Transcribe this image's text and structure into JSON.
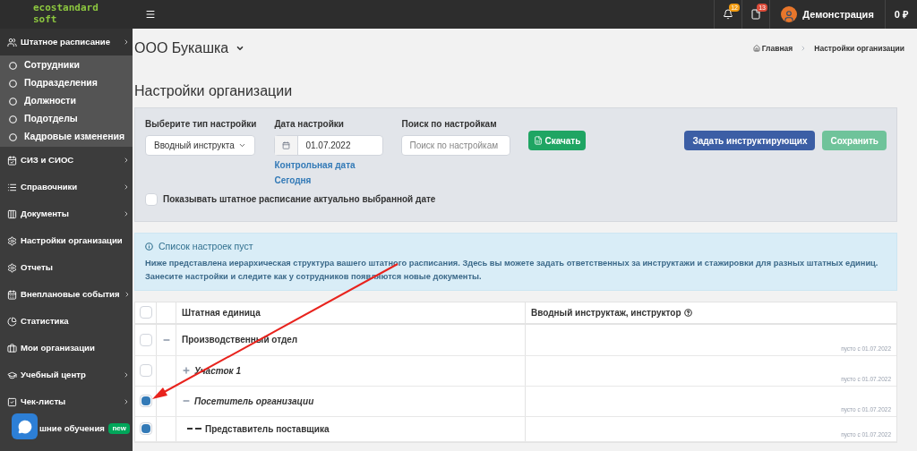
{
  "logo": {
    "line1": "ecostandard",
    "line2": "soft"
  },
  "sidebar": {
    "items": [
      {
        "label": "Штатное расписание",
        "has_submenu": true,
        "expanded": true,
        "children": [
          {
            "label": "Сотрудники"
          },
          {
            "label": "Подразделения"
          },
          {
            "label": "Должности"
          },
          {
            "label": "Подотделы"
          },
          {
            "label": "Кадровые изменения"
          }
        ]
      },
      {
        "label": "СИЗ и СИОС",
        "has_submenu": true
      },
      {
        "label": "Справочники",
        "has_submenu": true
      },
      {
        "label": "Документы",
        "has_submenu": true
      },
      {
        "label": "Настройки организации",
        "has_submenu": false
      },
      {
        "label": "Отчеты",
        "has_submenu": false
      },
      {
        "label": "Внеплановые события",
        "has_submenu": true
      },
      {
        "label": "Статистика",
        "has_submenu": false
      },
      {
        "label": "Мои организации",
        "has_submenu": false
      },
      {
        "label": "Учебный центр",
        "has_submenu": true
      },
      {
        "label": "Чек-листы",
        "has_submenu": true
      },
      {
        "label": "шние обучения",
        "has_submenu": false,
        "covered": true,
        "badge": "new"
      }
    ]
  },
  "top_bar": {
    "notifications": [
      {
        "badge": "12",
        "color": "#f39c12"
      },
      {
        "badge": "13",
        "color": "#dd4b39"
      }
    ],
    "user": "Демонстрация",
    "balance": "0 ₽"
  },
  "org_name": "ООО Букашка",
  "breadcrumbs": [
    "Главная",
    "Настройки организации"
  ],
  "page_title": "Настройки организации",
  "filters": {
    "type_label": "Выберите тип настройки",
    "type_value": "Вводный инструкта",
    "date_label": "Дата настройки",
    "date_value": "01.07.2022",
    "date_links": [
      "Контрольная дата",
      "Сегодня"
    ],
    "search_label": "Поиск по настройкам",
    "search_placeholder": "Поиск по настройкам",
    "download_button": "Скачать",
    "assign_button": "Задать инструктирующих",
    "save_button": "Сохранить",
    "save_disabled": true,
    "show_actual": {
      "label": "Показывать штатное расписание актуально выбранной дате",
      "checked": false
    }
  },
  "alert": {
    "title": "Список настроек пуст",
    "text": "Ниже представлена иерархическая структура вашего штатного расписания. Здесь вы можете задать ответственных за инструктажи и стажировки для разных штатных единиц. Занесите настройки и следите как у сотрудников появляются новые документы."
  },
  "table": {
    "columns": [
      "Штатная единица",
      "Вводный инструктаж, инструктор"
    ],
    "header_checked": false,
    "rows": [
      {
        "name": "Производственный отдел",
        "checked": false,
        "expanded": true,
        "note": "пусто с 01.07.2022",
        "children": [
          {
            "name": "Участок 1",
            "checked": false,
            "expanded": false,
            "note": "пусто с 01.07.2022"
          },
          {
            "name": "Посетитель организации",
            "checked": true,
            "expanded": true,
            "note": "пусто с 01.07.2022",
            "children": [
              {
                "name": "Представитель поставщика",
                "checked": true,
                "note": "пусто с 01.07.2022"
              }
            ]
          }
        ]
      }
    ]
  }
}
